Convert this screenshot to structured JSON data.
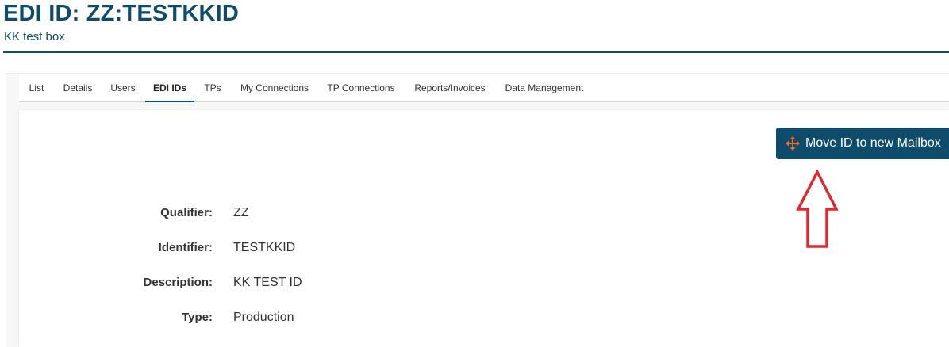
{
  "header": {
    "title": "EDI ID: ZZ:TESTKKID",
    "subtitle": "KK test box"
  },
  "tabs": [
    {
      "label": "List",
      "active": false
    },
    {
      "label": "Details",
      "active": false
    },
    {
      "label": "Users",
      "active": false
    },
    {
      "label": "EDI IDs",
      "active": true
    },
    {
      "label": "TPs",
      "active": false
    },
    {
      "label": "My Connections",
      "active": false
    },
    {
      "label": "TP Connections",
      "active": false
    },
    {
      "label": "Reports/Invoices",
      "active": false
    },
    {
      "label": "Data Management",
      "active": false
    }
  ],
  "actions": {
    "move_button_label": "Move ID to new Mailbox",
    "move_icon": "move-arrows-icon"
  },
  "annotation": {
    "arrow_icon": "red-up-arrow-icon",
    "color": "#e3262f"
  },
  "fields": [
    {
      "label": "Qualifier:",
      "value": "ZZ"
    },
    {
      "label": "Identifier:",
      "value": "TESTKKID"
    },
    {
      "label": "Description:",
      "value": "KK TEST ID"
    },
    {
      "label": "Type:",
      "value": "Production"
    }
  ],
  "colors": {
    "brand": "#0f4c6b",
    "icon_accent": "#f26b2f"
  }
}
